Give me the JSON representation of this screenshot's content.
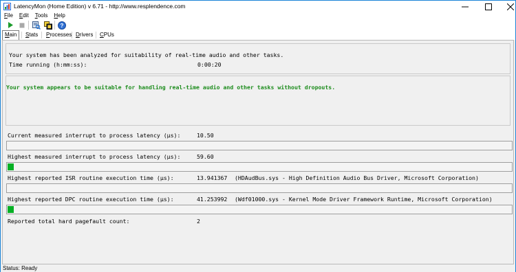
{
  "window": {
    "app_name": "LatencyMon",
    "edition": "(Home Edition)",
    "version": "v 6.71",
    "url": "http://www.resplendence.com"
  },
  "menu": [
    {
      "key": "F",
      "rest": "ile"
    },
    {
      "key": "E",
      "rest": "dit"
    },
    {
      "key": "T",
      "rest": "ools"
    },
    {
      "key": "H",
      "rest": "elp"
    }
  ],
  "toolbar": {
    "icons": [
      "play-icon",
      "stop-icon",
      "analyze-icon",
      "copy-icon",
      "help-icon"
    ],
    "accent": "#1c8c1c"
  },
  "tabs": [
    {
      "key": "M",
      "rest": "ain"
    },
    {
      "key": "S",
      "rest": "tats"
    },
    {
      "key": "P",
      "rest": "rocesses"
    },
    {
      "key": "D",
      "rest": "rivers"
    },
    {
      "key": "C",
      "rest": "PUs"
    }
  ],
  "main": {
    "summary_line": "Your system has been analyzed for suitability of real-time audio and other tasks.",
    "time_label": "Time running (h:mm:ss):",
    "time_value": "0:00:20",
    "verdict": "Your system appears to be suitable for handling real-time audio and other tasks without dropouts.",
    "verdict_color": "#1c8c1c",
    "metrics": [
      {
        "label": "Current measured interrupt to process latency (µs):",
        "value": "10.50",
        "detail": "",
        "level_percent": 0
      },
      {
        "label": "Highest measured interrupt to process latency (µs):",
        "value": "59.60",
        "detail": "",
        "level_percent": 1.2
      },
      {
        "label": "Highest reported ISR routine execution time (µs):",
        "value": "13.941367",
        "detail": "(HDAudBus.sys - High Definition Audio Bus Driver, Microsoft Corporation)",
        "level_percent": 0
      },
      {
        "label": "Highest reported DPC routine execution time (µs):",
        "value": "41.253992",
        "detail": "(Wdf01000.sys - Kernel Mode Driver Framework Runtime, Microsoft Corporation)",
        "level_percent": 1.2
      },
      {
        "label": "Reported total hard pagefault count:",
        "value": "2",
        "detail": "",
        "level_percent": null
      }
    ]
  },
  "status": {
    "text": "Status: Ready"
  }
}
